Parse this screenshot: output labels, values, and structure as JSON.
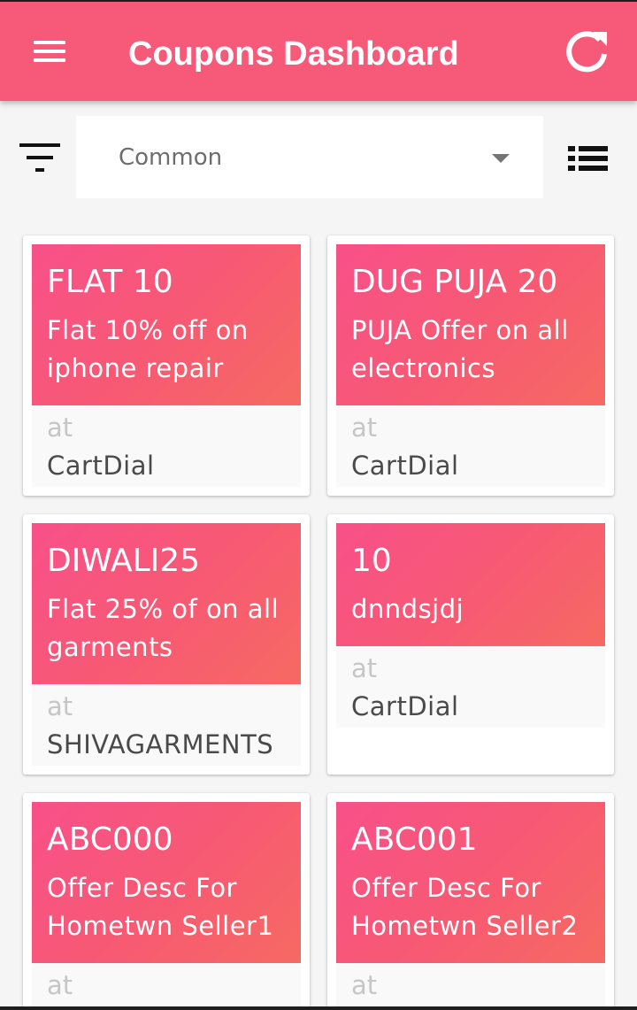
{
  "appbar": {
    "title": "Coupons Dashboard",
    "menu_icon": "hamburger-menu-icon",
    "refresh_icon": "refresh-icon",
    "color": "#f65a78"
  },
  "filter_bar": {
    "filter_icon": "filter-icon",
    "selected_category": "Common",
    "list_view_icon": "list-view-icon"
  },
  "coupons": [
    {
      "code": "FLAT 10",
      "description": "Flat 10% off on iphone repair",
      "at_label": "at",
      "store": "CartDial"
    },
    {
      "code": "DUG PUJA 20",
      "description": "PUJA Offer on all electronics",
      "at_label": "at",
      "store": "CartDial"
    },
    {
      "code": "DIWALI25",
      "description": "Flat 25% of on all garments",
      "at_label": "at",
      "store": "SHIVAGARMENTS"
    },
    {
      "code": "10",
      "description": "dnndsjdj",
      "at_label": "at",
      "store": "CartDial"
    },
    {
      "code": "ABC000",
      "description": "Offer Desc For Hometwn Seller1",
      "at_label": "at",
      "store": ""
    },
    {
      "code": "ABC001",
      "description": "Offer Desc For Hometwn Seller2",
      "at_label": "at",
      "store": ""
    }
  ]
}
